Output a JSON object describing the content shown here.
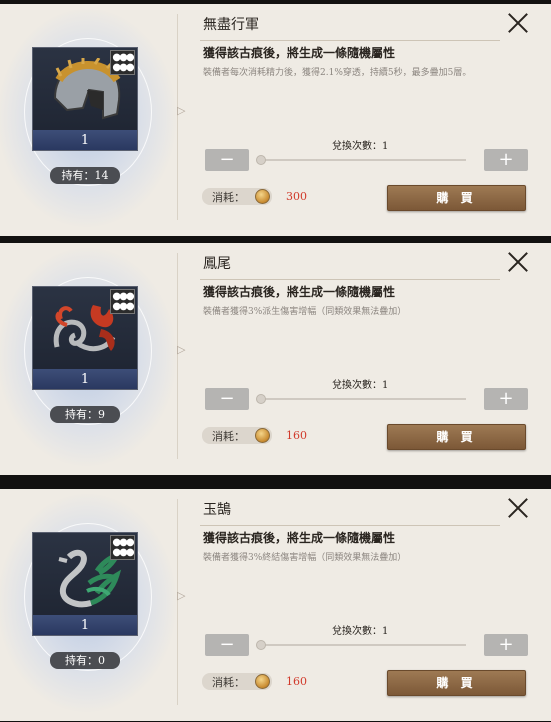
{
  "items": [
    {
      "name": "無盡行軍",
      "heading": "獲得該古痕後，將生成一條隨機屬性",
      "description": "裝備者每次消耗精力後，獲得2.1%穿透，持續5秒，最多疊加5層。",
      "level": "1",
      "owned": "持有：14",
      "exchange_count": "兌換次數：1",
      "cost_label": "消耗：",
      "cost_value": "300",
      "buy_label": "購 買",
      "icon": "helmet-icon",
      "colors": {
        "cost": "#d13a2b",
        "buy": "#8f6a45"
      }
    },
    {
      "name": "鳳尾",
      "heading": "獲得該古痕後，將生成一條隨機屬性",
      "description": "裝備者獲得3%派生傷害增幅（同類效果無法疊加）",
      "level": "1",
      "owned": "持有：9",
      "exchange_count": "兌換次數：1",
      "cost_label": "消耗：",
      "cost_value": "160",
      "buy_label": "購 買",
      "icon": "phoenix-tail-icon",
      "colors": {
        "cost": "#d13a2b",
        "buy": "#8f6a45"
      }
    },
    {
      "name": "玉鵠",
      "heading": "獲得該古痕後，將生成一條隨機屬性",
      "description": "裝備者獲得3%終結傷害增幅（同類效果無法疊加）",
      "level": "1",
      "owned": "持有：0",
      "exchange_count": "兌換次數：1",
      "cost_label": "消耗：",
      "cost_value": "160",
      "buy_label": "購 買",
      "icon": "jade-swan-icon",
      "colors": {
        "cost": "#d13a2b",
        "buy": "#8f6a45"
      }
    }
  ],
  "controls": {
    "minus_label": "−",
    "plus_label": "+",
    "badge_icon": "dots-cluster-icon",
    "close_icon": "close-icon",
    "coin_icon": "coin-icon"
  }
}
